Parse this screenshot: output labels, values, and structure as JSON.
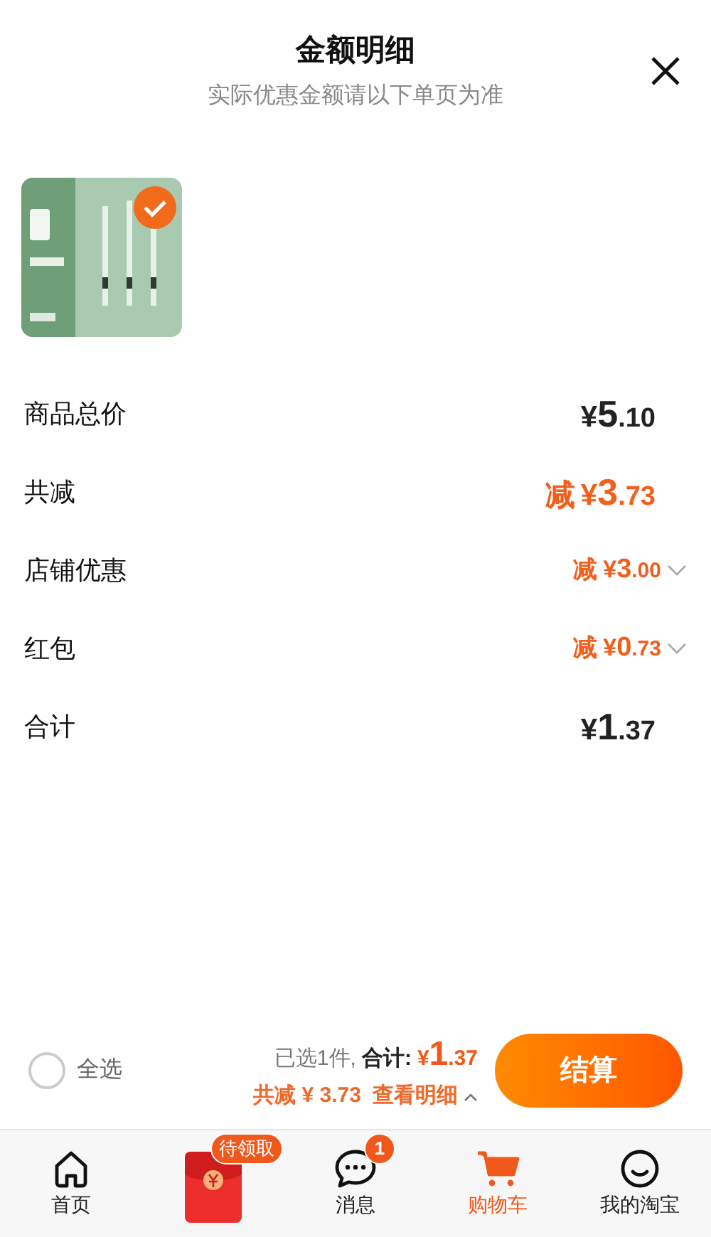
{
  "header": {
    "title": "金额明细",
    "subtitle": "实际优惠金额请以下单页为准"
  },
  "product": {
    "kind": "picture",
    "checked": true
  },
  "rows": [
    {
      "label": "商品总价",
      "kind": "total",
      "prefix": "",
      "symbol": "¥",
      "major": "5",
      "minor": ".10",
      "expandable": false
    },
    {
      "label": "共减",
      "kind": "discount-main",
      "prefix": "减",
      "symbol": "¥",
      "major": "3",
      "minor": ".73",
      "expandable": false
    },
    {
      "label": "店铺优惠",
      "kind": "discount",
      "prefix": "减",
      "symbol": "¥",
      "major": "3",
      "minor": ".00",
      "expandable": true
    },
    {
      "label": "红包",
      "kind": "discount",
      "prefix": "减",
      "symbol": "¥",
      "major": "0",
      "minor": ".73",
      "expandable": true
    },
    {
      "label": "合计",
      "kind": "total",
      "prefix": "",
      "symbol": "¥",
      "major": "1",
      "minor": ".37",
      "expandable": false
    }
  ],
  "footer": {
    "select_all": {
      "label": "全选",
      "checked": false
    },
    "selected_count": "已选1件,",
    "total_label": "合计:",
    "total_symbol": "¥",
    "total_major": "1",
    "total_minor": ".37",
    "saving": "共减 ¥ 3.73",
    "details_link": "查看明细",
    "checkout": "结算"
  },
  "tabs": [
    {
      "kind": "home",
      "label": "首页",
      "selected": false
    },
    {
      "kind": "redpacket",
      "badge": "待领取",
      "selected": false
    },
    {
      "kind": "message",
      "label": "消息",
      "badge": "1",
      "selected": false
    },
    {
      "kind": "cart",
      "label": "购物车",
      "selected": true
    },
    {
      "kind": "profile",
      "label": "我的淘宝",
      "selected": false
    }
  ]
}
